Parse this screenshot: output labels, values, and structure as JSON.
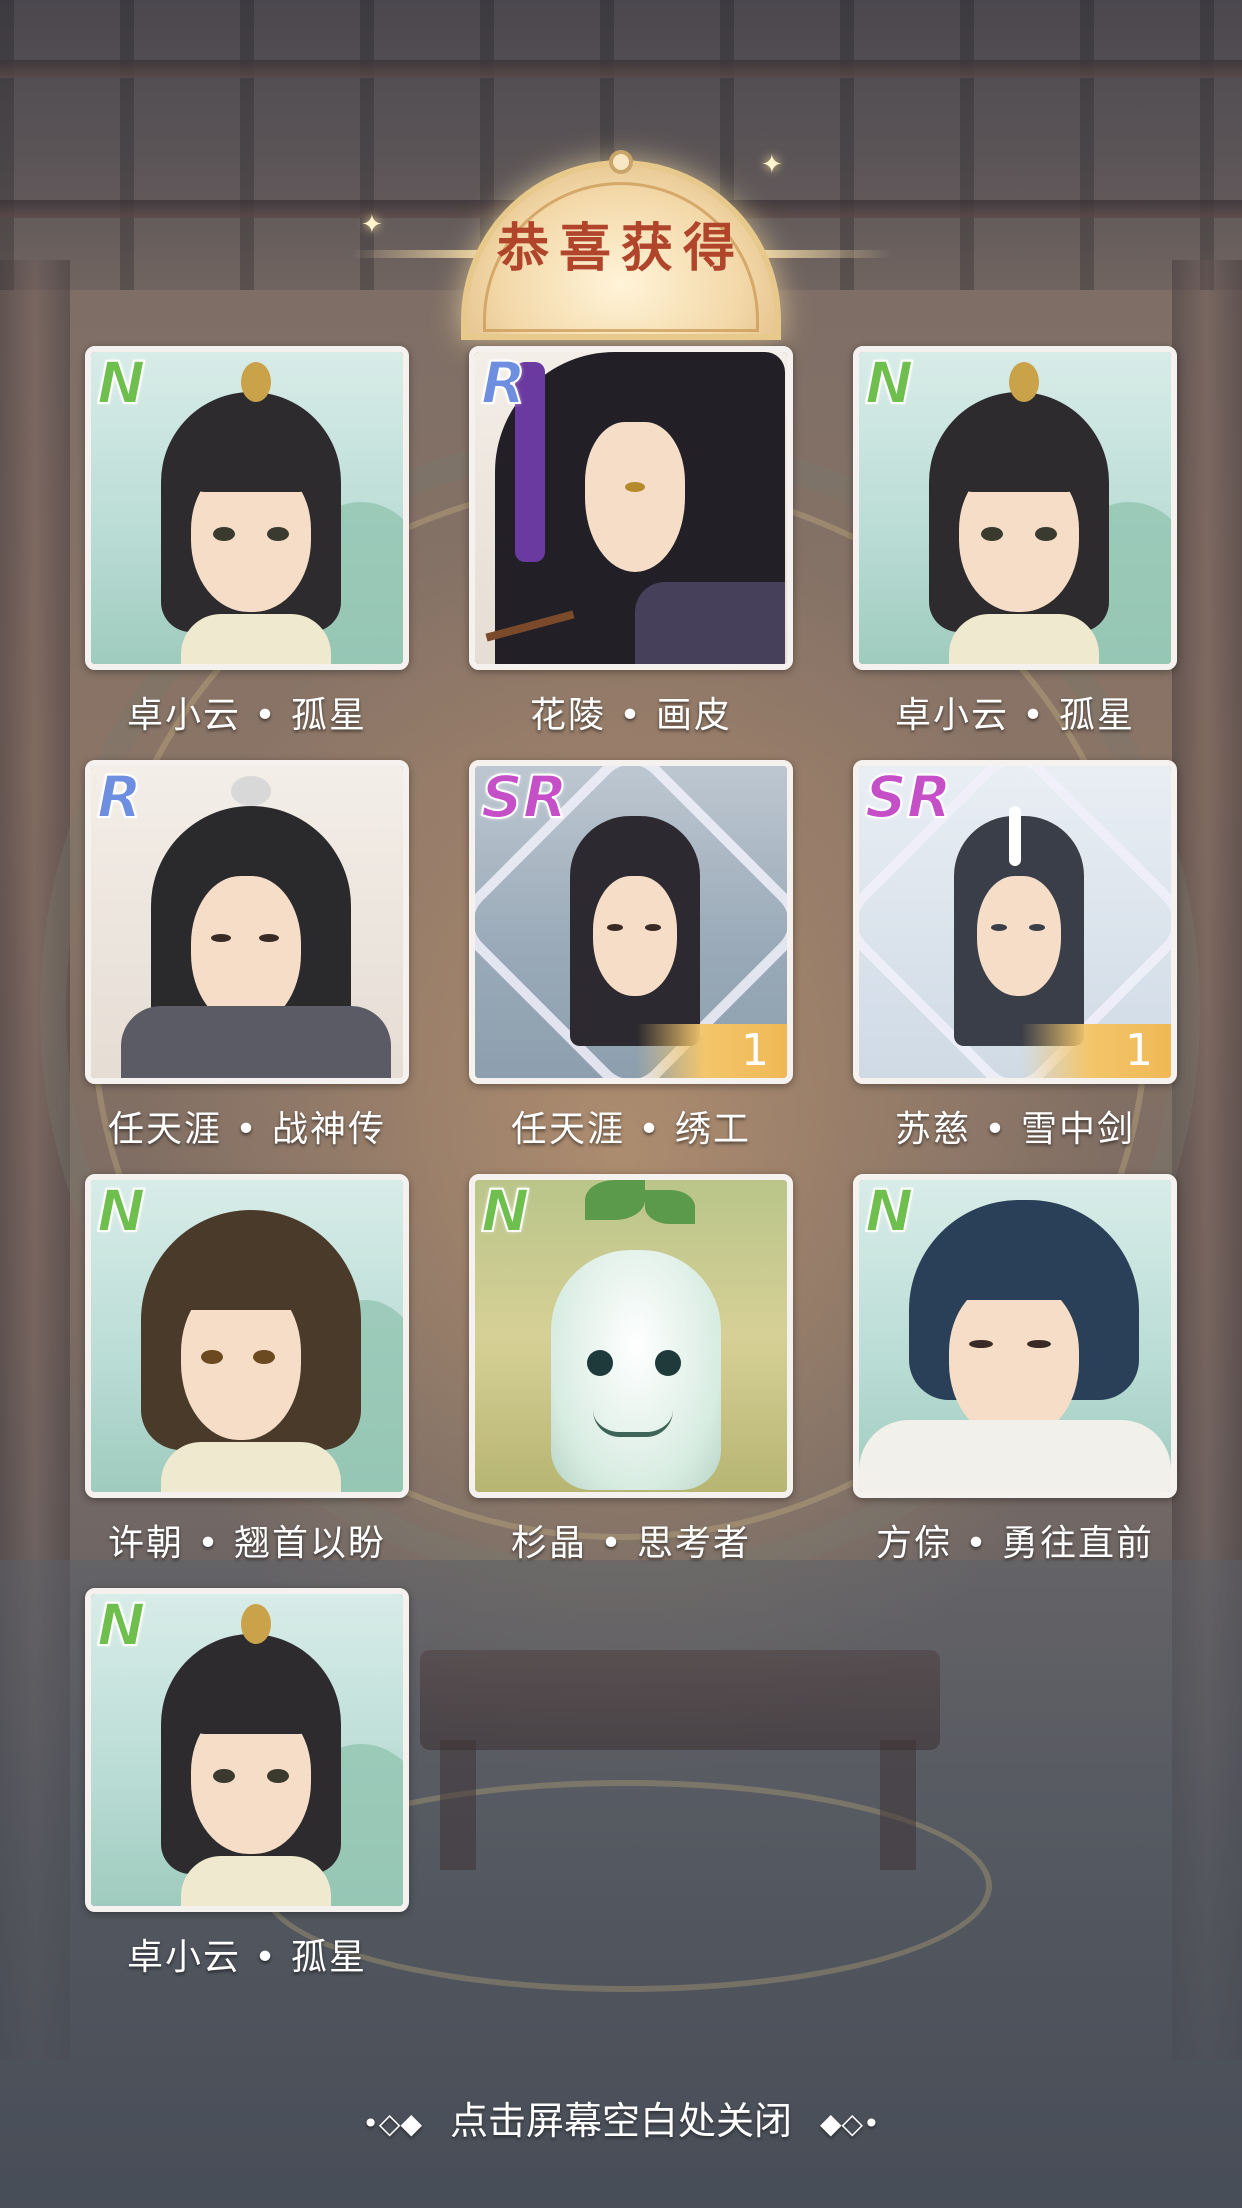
{
  "title": "恭喜获得",
  "close_hint": "点击屏幕空白处关闭",
  "deco_left": "•◇◆",
  "deco_right": "◆◇•",
  "rarity_colors": {
    "N": "#6fbf4e",
    "R": "#6e8fe0",
    "SR": "#c54fc7",
    "count_tag": "#f3c66b"
  },
  "cards": [
    {
      "rarity": "N",
      "name": "卓小云 • 孤星",
      "count": "",
      "icon": "portrait-zhuo-xiaoyun"
    },
    {
      "rarity": "R",
      "name": "花陵 • 画皮",
      "count": "",
      "icon": "portrait-hua-ling"
    },
    {
      "rarity": "N",
      "name": "卓小云 • 孤星",
      "count": "",
      "icon": "portrait-zhuo-xiaoyun"
    },
    {
      "rarity": "R",
      "name": "任天涯 • 战神传",
      "count": "",
      "icon": "portrait-ren-tianya"
    },
    {
      "rarity": "SR",
      "name": "任天涯 • 绣工",
      "count": "1",
      "icon": "portrait-ren-tianya-sr"
    },
    {
      "rarity": "SR",
      "name": "苏慈 • 雪中剑",
      "count": "1",
      "icon": "portrait-su-ci-sr"
    },
    {
      "rarity": "N",
      "name": "许朝 • 翘首以盼",
      "count": "",
      "icon": "portrait-xu-chao"
    },
    {
      "rarity": "N",
      "name": "杉晶 • 思考者",
      "count": "",
      "icon": "portrait-shan-jing"
    },
    {
      "rarity": "N",
      "name": "方倧 • 勇往直前",
      "count": "",
      "icon": "portrait-fang-zong"
    },
    {
      "rarity": "N",
      "name": "卓小云 • 孤星",
      "count": "",
      "icon": "portrait-zhuo-xiaoyun"
    }
  ]
}
